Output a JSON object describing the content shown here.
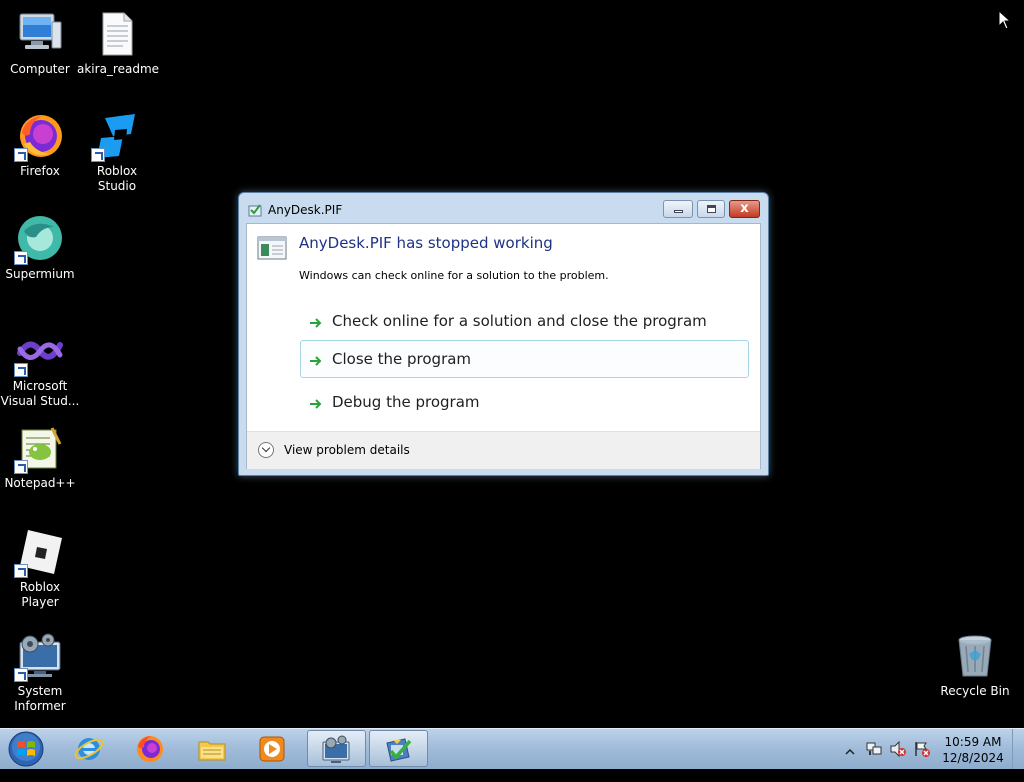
{
  "desktop": {
    "icons": [
      {
        "label": "Computer"
      },
      {
        "label": "akira_readme"
      },
      {
        "label": "Firefox"
      },
      {
        "label": "Roblox Studio"
      },
      {
        "label": "Supermium"
      },
      {
        "label": "Microsoft Visual Stud..."
      },
      {
        "label": "Notepad++"
      },
      {
        "label": "Roblox Player"
      },
      {
        "label": "System Informer"
      },
      {
        "label": "Recycle Bin"
      }
    ]
  },
  "dialog": {
    "title": "AnyDesk.PIF",
    "headline": "AnyDesk.PIF has stopped working",
    "subtext": "Windows can check online for a solution to the problem.",
    "options": [
      {
        "label": "Check online for a solution and close the program"
      },
      {
        "label": "Close the program"
      },
      {
        "label": "Debug the program"
      }
    ],
    "details_label": "View problem details",
    "close_glyph": "x"
  },
  "taskbar": {
    "apps": [
      {
        "icon": "internet-explorer-icon"
      },
      {
        "icon": "firefox-icon"
      },
      {
        "icon": "file-explorer-icon"
      },
      {
        "icon": "media-player-icon"
      },
      {
        "icon": "system-informer-icon"
      },
      {
        "icon": "problem-reporting-icon"
      }
    ],
    "clock": {
      "time": "10:59 AM",
      "date": "12/8/2024"
    }
  },
  "colors": {
    "headline": "#1e3287",
    "arrow": "#2aa43a",
    "desktop": "#000000",
    "close_button": "#c23a22"
  }
}
